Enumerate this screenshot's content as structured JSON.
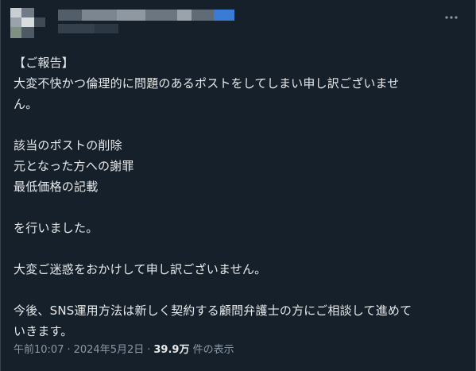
{
  "header": {
    "more_icon": "more-horizontal-icon"
  },
  "post": {
    "lines": [
      "【ご報告】",
      "大変不快かつ倫理的に問題のあるポストをしてしまい申し訳ございませ",
      "ん。",
      "",
      "該当のポストの削除",
      "元となった方への謝罪",
      "最低価格の記載",
      "",
      "を行いました。",
      "",
      "大変ご迷惑をおかけして申し訳ございません。",
      "",
      "今後、SNS運用方法は新しく契約する顧問弁護士の方にご相談して進めて",
      "いきます。"
    ]
  },
  "meta": {
    "time": "午前10:07",
    "separator": "·",
    "date": "2024年5月2日",
    "views_count": "39.9万",
    "views_label": "件の表示"
  },
  "colors": {
    "background": "#15202b",
    "text": "#e7e9ea",
    "secondary": "#8b98a5",
    "border": "#38444d"
  }
}
